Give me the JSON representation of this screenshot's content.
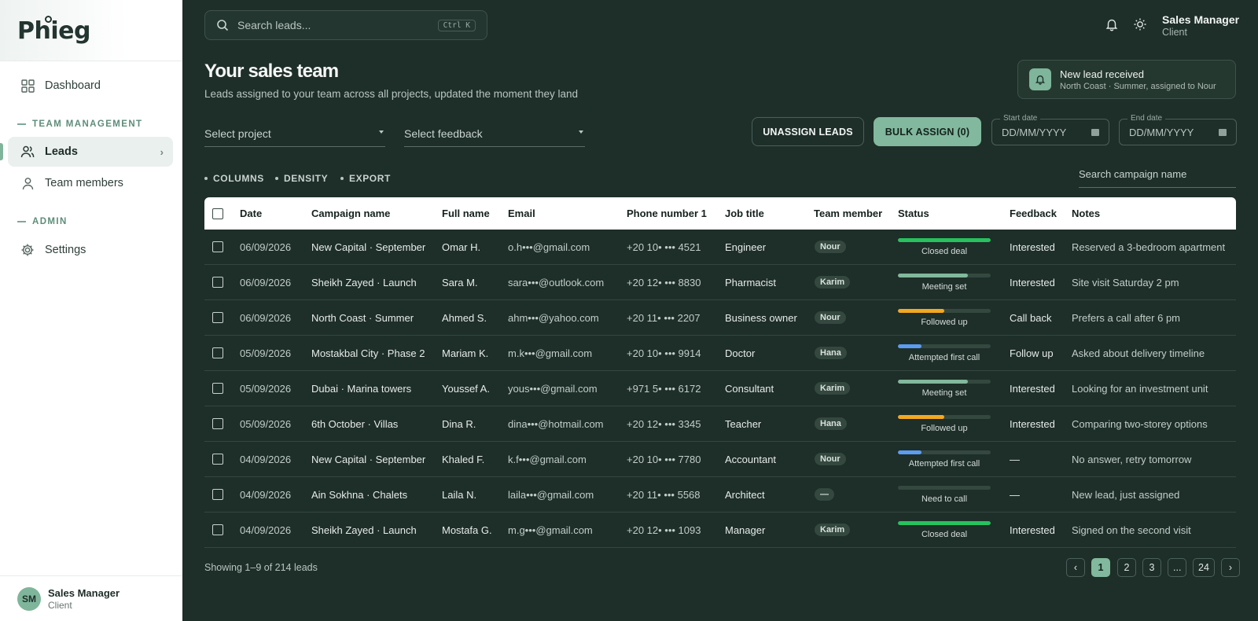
{
  "brand": {
    "name": "Phieg"
  },
  "sidebar": {
    "items": [
      {
        "label": "Dashboard",
        "icon": "grid-icon"
      },
      {
        "label": "Leads",
        "icon": "users-icon"
      },
      {
        "label": "Team members",
        "icon": "user-icon"
      },
      {
        "label": "Settings",
        "icon": "gear-icon"
      }
    ],
    "sections": {
      "team": "TEAM MANAGEMENT",
      "admin": "ADMIN"
    },
    "user": {
      "initials": "SM",
      "name": "Sales Manager",
      "role": "Client"
    }
  },
  "topbar": {
    "search_placeholder": "Search leads...",
    "shortcut": "Ctrl K",
    "user_name": "Sales Manager",
    "user_role": "Client"
  },
  "page": {
    "title": "Your sales team",
    "subtitle": "Leads assigned to your team across all projects, updated the moment they land"
  },
  "toast": {
    "title": "New lead received",
    "subtitle": "North Coast · Summer, assigned to Nour"
  },
  "filters": {
    "project": "Select project",
    "feedback": "Select feedback",
    "unassign": "UNASSIGN LEADS",
    "bulk_assign": "BULK ASSIGN (0)",
    "start_label": "Start date",
    "end_label": "End date",
    "date_placeholder": "DD/MM/YYYY"
  },
  "toolbar": {
    "columns": "COLUMNS",
    "density": "DENSITY",
    "export": "EXPORT",
    "campaign_search_placeholder": "Search campaign name"
  },
  "table": {
    "headers": [
      "Date",
      "Campaign name",
      "Full name",
      "Email",
      "Phone number 1",
      "Job title",
      "Team member",
      "Status",
      "Feedback",
      "Notes"
    ],
    "rows": [
      {
        "date": "06/09/2026",
        "campaign": "New Capital · September",
        "name": "Omar H.",
        "email": "o.h•••@gmail.com",
        "phone": "+20 10• ••• 4521",
        "job": "Engineer",
        "member": "Nour",
        "status": "Closed deal",
        "progress": 1.0,
        "color": "#27c25e",
        "feedback": "Interested",
        "notes": "Reserved a 3-bedroom apartment"
      },
      {
        "date": "06/09/2026",
        "campaign": "Sheikh Zayed · Launch",
        "name": "Sara M.",
        "email": "sara•••@outlook.com",
        "phone": "+20 12• ••• 8830",
        "job": "Pharmacist",
        "member": "Karim",
        "status": "Meeting set",
        "progress": 0.75,
        "color": "#82b89d",
        "feedback": "Interested",
        "notes": "Site visit Saturday 2 pm"
      },
      {
        "date": "06/09/2026",
        "campaign": "North Coast · Summer",
        "name": "Ahmed S.",
        "email": "ahm•••@yahoo.com",
        "phone": "+20 11• ••• 2207",
        "job": "Business owner",
        "member": "Nour",
        "status": "Followed up",
        "progress": 0.5,
        "color": "#f3a821",
        "feedback": "Call back",
        "notes": "Prefers a call after 6 pm"
      },
      {
        "date": "05/09/2026",
        "campaign": "Mostakbal City · Phase 2",
        "name": "Mariam K.",
        "email": "m.k•••@gmail.com",
        "phone": "+20 10• ••• 9914",
        "job": "Doctor",
        "member": "Hana",
        "status": "Attempted first call",
        "progress": 0.25,
        "color": "#5b9cf0",
        "feedback": "Follow up",
        "notes": "Asked about delivery timeline"
      },
      {
        "date": "05/09/2026",
        "campaign": "Dubai · Marina towers",
        "name": "Youssef A.",
        "email": "yous•••@gmail.com",
        "phone": "+971 5• ••• 6172",
        "job": "Consultant",
        "member": "Karim",
        "status": "Meeting set",
        "progress": 0.75,
        "color": "#82b89d",
        "feedback": "Interested",
        "notes": "Looking for an investment unit"
      },
      {
        "date": "05/09/2026",
        "campaign": "6th October · Villas",
        "name": "Dina R.",
        "email": "dina•••@hotmail.com",
        "phone": "+20 12• ••• 3345",
        "job": "Teacher",
        "member": "Hana",
        "status": "Followed up",
        "progress": 0.5,
        "color": "#f3a821",
        "feedback": "Interested",
        "notes": "Comparing two-storey options"
      },
      {
        "date": "04/09/2026",
        "campaign": "New Capital · September",
        "name": "Khaled F.",
        "email": "k.f•••@gmail.com",
        "phone": "+20 10• ••• 7780",
        "job": "Accountant",
        "member": "Nour",
        "status": "Attempted first call",
        "progress": 0.25,
        "color": "#5b9cf0",
        "feedback": "—",
        "notes": "No answer, retry tomorrow"
      },
      {
        "date": "04/09/2026",
        "campaign": "Ain Sokhna · Chalets",
        "name": "Laila N.",
        "email": "laila•••@gmail.com",
        "phone": "+20 11• ••• 5568",
        "job": "Architect",
        "member": "—",
        "status": "Need to call",
        "progress": 0.0,
        "color": "#5b9cf0",
        "feedback": "—",
        "notes": "New lead, just assigned"
      },
      {
        "date": "04/09/2026",
        "campaign": "Sheikh Zayed · Launch",
        "name": "Mostafa G.",
        "email": "m.g•••@gmail.com",
        "phone": "+20 12• ••• 1093",
        "job": "Manager",
        "member": "Karim",
        "status": "Closed deal",
        "progress": 1.0,
        "color": "#27c25e",
        "feedback": "Interested",
        "notes": "Signed on the second visit"
      }
    ]
  },
  "footer": {
    "showing": "Showing 1–9 of 214 leads",
    "pages": [
      "‹",
      "1",
      "2",
      "3",
      "...",
      "24",
      "›"
    ],
    "current": "1"
  }
}
